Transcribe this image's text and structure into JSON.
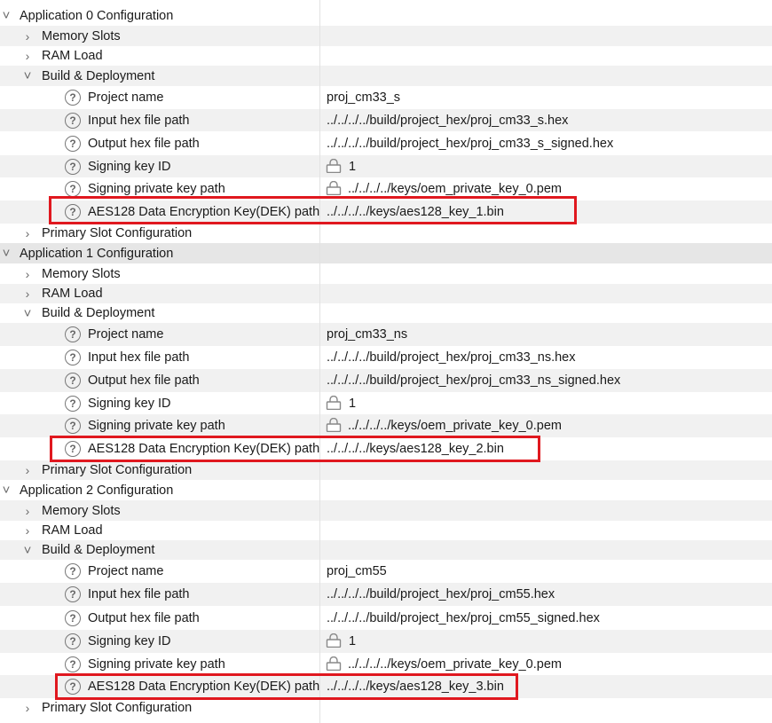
{
  "rows": [
    {
      "type": "group",
      "level": 1,
      "expanded": true,
      "label": "Application 0 Configuration",
      "alt": false
    },
    {
      "type": "group",
      "level": 2,
      "expanded": false,
      "label": "Memory Slots",
      "alt": true
    },
    {
      "type": "group",
      "level": 2,
      "expanded": false,
      "label": "RAM Load",
      "alt": false
    },
    {
      "type": "group",
      "level": 2,
      "expanded": true,
      "label": "Build & Deployment",
      "alt": true
    },
    {
      "type": "prop",
      "label": "Project name",
      "value": "proj_cm33_s",
      "alt": false
    },
    {
      "type": "prop",
      "label": "Input hex file path",
      "value": "../../../../build/project_hex/proj_cm33_s.hex",
      "alt": true
    },
    {
      "type": "prop",
      "label": "Output hex file path",
      "value": "../../../../build/project_hex/proj_cm33_s_signed.hex",
      "alt": false
    },
    {
      "type": "prop",
      "label": "Signing key ID",
      "value": "1",
      "lock": true,
      "alt": true
    },
    {
      "type": "prop",
      "label": "Signing private key path",
      "value": "../../../../keys/oem_private_key_0.pem",
      "lock": true,
      "alt": false
    },
    {
      "type": "prop",
      "label": "AES128 Data Encryption Key(DEK) path",
      "value": "../../../../keys/aes128_key_1.bin",
      "alt": true
    },
    {
      "type": "group",
      "level": 2,
      "expanded": false,
      "label": "Primary Slot Configuration",
      "alt": false
    },
    {
      "type": "group",
      "level": 1,
      "expanded": true,
      "label": "Application 1 Configuration",
      "alt": true,
      "selected": true
    },
    {
      "type": "group",
      "level": 2,
      "expanded": false,
      "label": "Memory Slots",
      "alt": false
    },
    {
      "type": "group",
      "level": 2,
      "expanded": false,
      "label": "RAM Load",
      "alt": true
    },
    {
      "type": "group",
      "level": 2,
      "expanded": true,
      "label": "Build & Deployment",
      "alt": false
    },
    {
      "type": "prop",
      "label": "Project name",
      "value": "proj_cm33_ns",
      "alt": true
    },
    {
      "type": "prop",
      "label": "Input hex file path",
      "value": "../../../../build/project_hex/proj_cm33_ns.hex",
      "alt": false
    },
    {
      "type": "prop",
      "label": "Output hex file path",
      "value": "../../../../build/project_hex/proj_cm33_ns_signed.hex",
      "alt": true
    },
    {
      "type": "prop",
      "label": "Signing key ID",
      "value": "1",
      "lock": true,
      "alt": false
    },
    {
      "type": "prop",
      "label": "Signing private key path",
      "value": "../../../../keys/oem_private_key_0.pem",
      "lock": true,
      "alt": true
    },
    {
      "type": "prop",
      "label": "AES128 Data Encryption Key(DEK) path",
      "value": "../../../../keys/aes128_key_2.bin",
      "alt": false
    },
    {
      "type": "group",
      "level": 2,
      "expanded": false,
      "label": "Primary Slot Configuration",
      "alt": true
    },
    {
      "type": "group",
      "level": 1,
      "expanded": true,
      "label": "Application 2 Configuration",
      "alt": false
    },
    {
      "type": "group",
      "level": 2,
      "expanded": false,
      "label": "Memory Slots",
      "alt": true
    },
    {
      "type": "group",
      "level": 2,
      "expanded": false,
      "label": "RAM Load",
      "alt": false
    },
    {
      "type": "group",
      "level": 2,
      "expanded": true,
      "label": "Build & Deployment",
      "alt": true
    },
    {
      "type": "prop",
      "label": "Project name",
      "value": "proj_cm55",
      "alt": false
    },
    {
      "type": "prop",
      "label": "Input hex file path",
      "value": "../../../../build/project_hex/proj_cm55.hex",
      "alt": true
    },
    {
      "type": "prop",
      "label": "Output hex file path",
      "value": "../../../../build/project_hex/proj_cm55_signed.hex",
      "alt": false
    },
    {
      "type": "prop",
      "label": "Signing key ID",
      "value": "1",
      "lock": true,
      "alt": true
    },
    {
      "type": "prop",
      "label": "Signing private key path",
      "value": "../../../../keys/oem_private_key_0.pem",
      "lock": true,
      "alt": false
    },
    {
      "type": "prop",
      "label": "AES128 Data Encryption Key(DEK) path",
      "value": "../../../../keys/aes128_key_3.bin",
      "alt": true
    },
    {
      "type": "group",
      "level": 2,
      "expanded": false,
      "label": "Primary Slot Configuration",
      "alt": false
    }
  ],
  "highlighted_rows": [
    9,
    20,
    31
  ],
  "colors": {
    "highlight": "#e0181f",
    "alt_row": "#f1f1f1",
    "divider": "#e2e2e2"
  },
  "icons": {
    "help": "question-circle-icon",
    "lock": "lock-icon",
    "expanded": "chevron-down-icon",
    "collapsed": "chevron-right-icon"
  }
}
